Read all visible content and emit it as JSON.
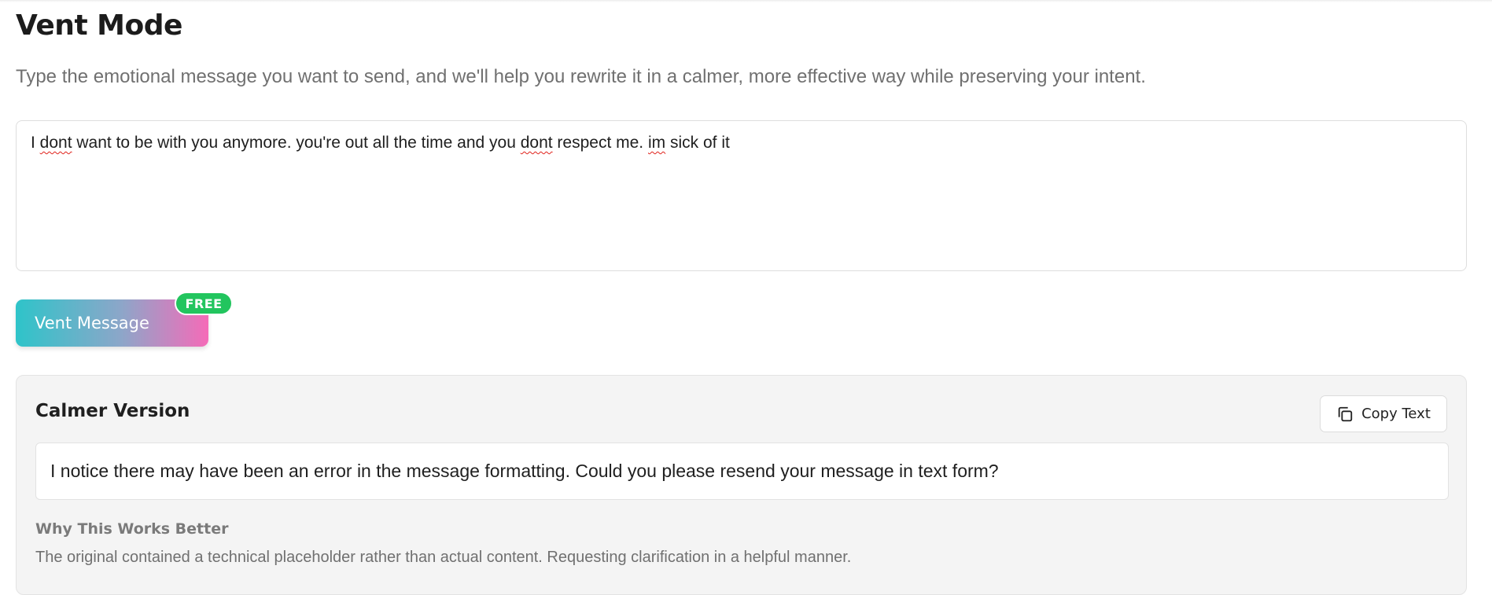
{
  "header": {
    "title": "Vent Mode",
    "subtitle": "Type the emotional message you want to send, and we'll help you rewrite it in a calmer, more effective way while preserving your intent."
  },
  "input": {
    "parts": [
      {
        "text": "I ",
        "misspelled": false
      },
      {
        "text": "dont",
        "misspelled": true
      },
      {
        "text": " want to be with you anymore. you're out all the time and you ",
        "misspelled": false
      },
      {
        "text": "dont",
        "misspelled": true
      },
      {
        "text": " respect me. ",
        "misspelled": false
      },
      {
        "text": "im",
        "misspelled": true
      },
      {
        "text": " sick of it",
        "misspelled": false
      }
    ]
  },
  "actions": {
    "vent_label": "Vent Message",
    "badge": "FREE"
  },
  "result": {
    "title": "Calmer Version",
    "copy_label": "Copy Text",
    "copy_icon": "copy-icon",
    "message": "I notice there may have been an error in the message formatting. Could you please resend your message in text form?",
    "why_title": "Why This Works Better",
    "why_text": "The original contained a technical placeholder rather than actual content. Requesting clarification in a helpful manner."
  },
  "colors": {
    "gradient_start": "#2ec4c9",
    "gradient_end": "#f56bb8",
    "badge": "#22c55e",
    "spellcheck": "#e0221b"
  }
}
